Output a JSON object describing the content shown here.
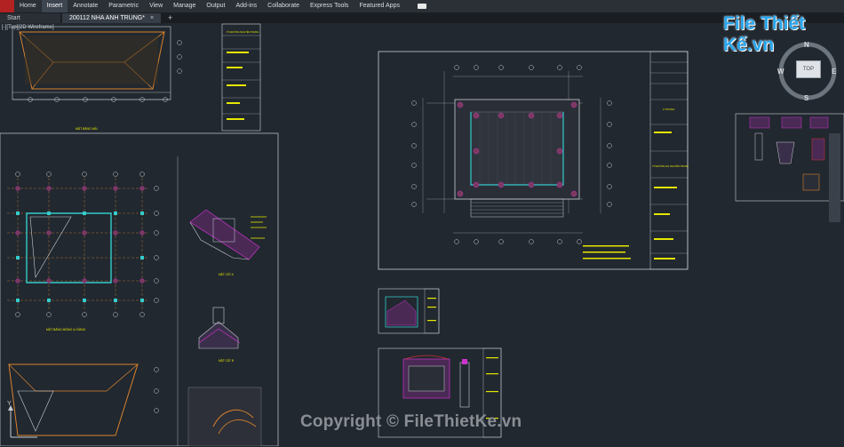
{
  "ribbon": {
    "items": [
      {
        "label": "Home"
      },
      {
        "label": "Insert",
        "active": true
      },
      {
        "label": "Annotate"
      },
      {
        "label": "Parametric"
      },
      {
        "label": "View"
      },
      {
        "label": "Manage"
      },
      {
        "label": "Output"
      },
      {
        "label": "Add-ins"
      },
      {
        "label": "Collaborate"
      },
      {
        "label": "Express Tools"
      },
      {
        "label": "Featured Apps"
      }
    ]
  },
  "tabs": {
    "start": "Start",
    "document": "200112 NHA ANH TRUNG*",
    "close": "×",
    "add": "+"
  },
  "viewport": {
    "label": "[-][Top][2D Wireframe]"
  },
  "viewcube": {
    "north": "N",
    "south": "S",
    "east": "E",
    "west": "W",
    "top": "TOP"
  },
  "ucs": {
    "y": "Y"
  },
  "drawing_labels": {
    "roof_plan": "MẶT BẰNG MÁI",
    "foundation_plan": "MẶT BẰNG MÓNG & GIẰNG",
    "section_a": "MẶT CẮT A",
    "section_b": "MẶT CẮT B",
    "company": "CÔNG TY KIẾN TRÚC",
    "project_1": "TỔ ĐƯỜNG NGUYỄN TRUNG",
    "project_2": "TỔ ĐƯỜNG HỌ NGUYỄN TRUNG",
    "sheet_a": "A TRUNG"
  },
  "watermarks": {
    "brand": "File Thiết Kế.vn",
    "copyright": "Copyright © FileThietKe.vn"
  },
  "colors": {
    "canvas": "#212830",
    "ribbon": "#2b3037",
    "line_white": "#c9cdd2",
    "line_yellow": "#e6e600",
    "line_orange": "#d9822b",
    "line_red": "#cc3333",
    "line_cyan": "#33cccc",
    "line_magenta": "#cc33cc",
    "brand": "#2aa6ee"
  }
}
